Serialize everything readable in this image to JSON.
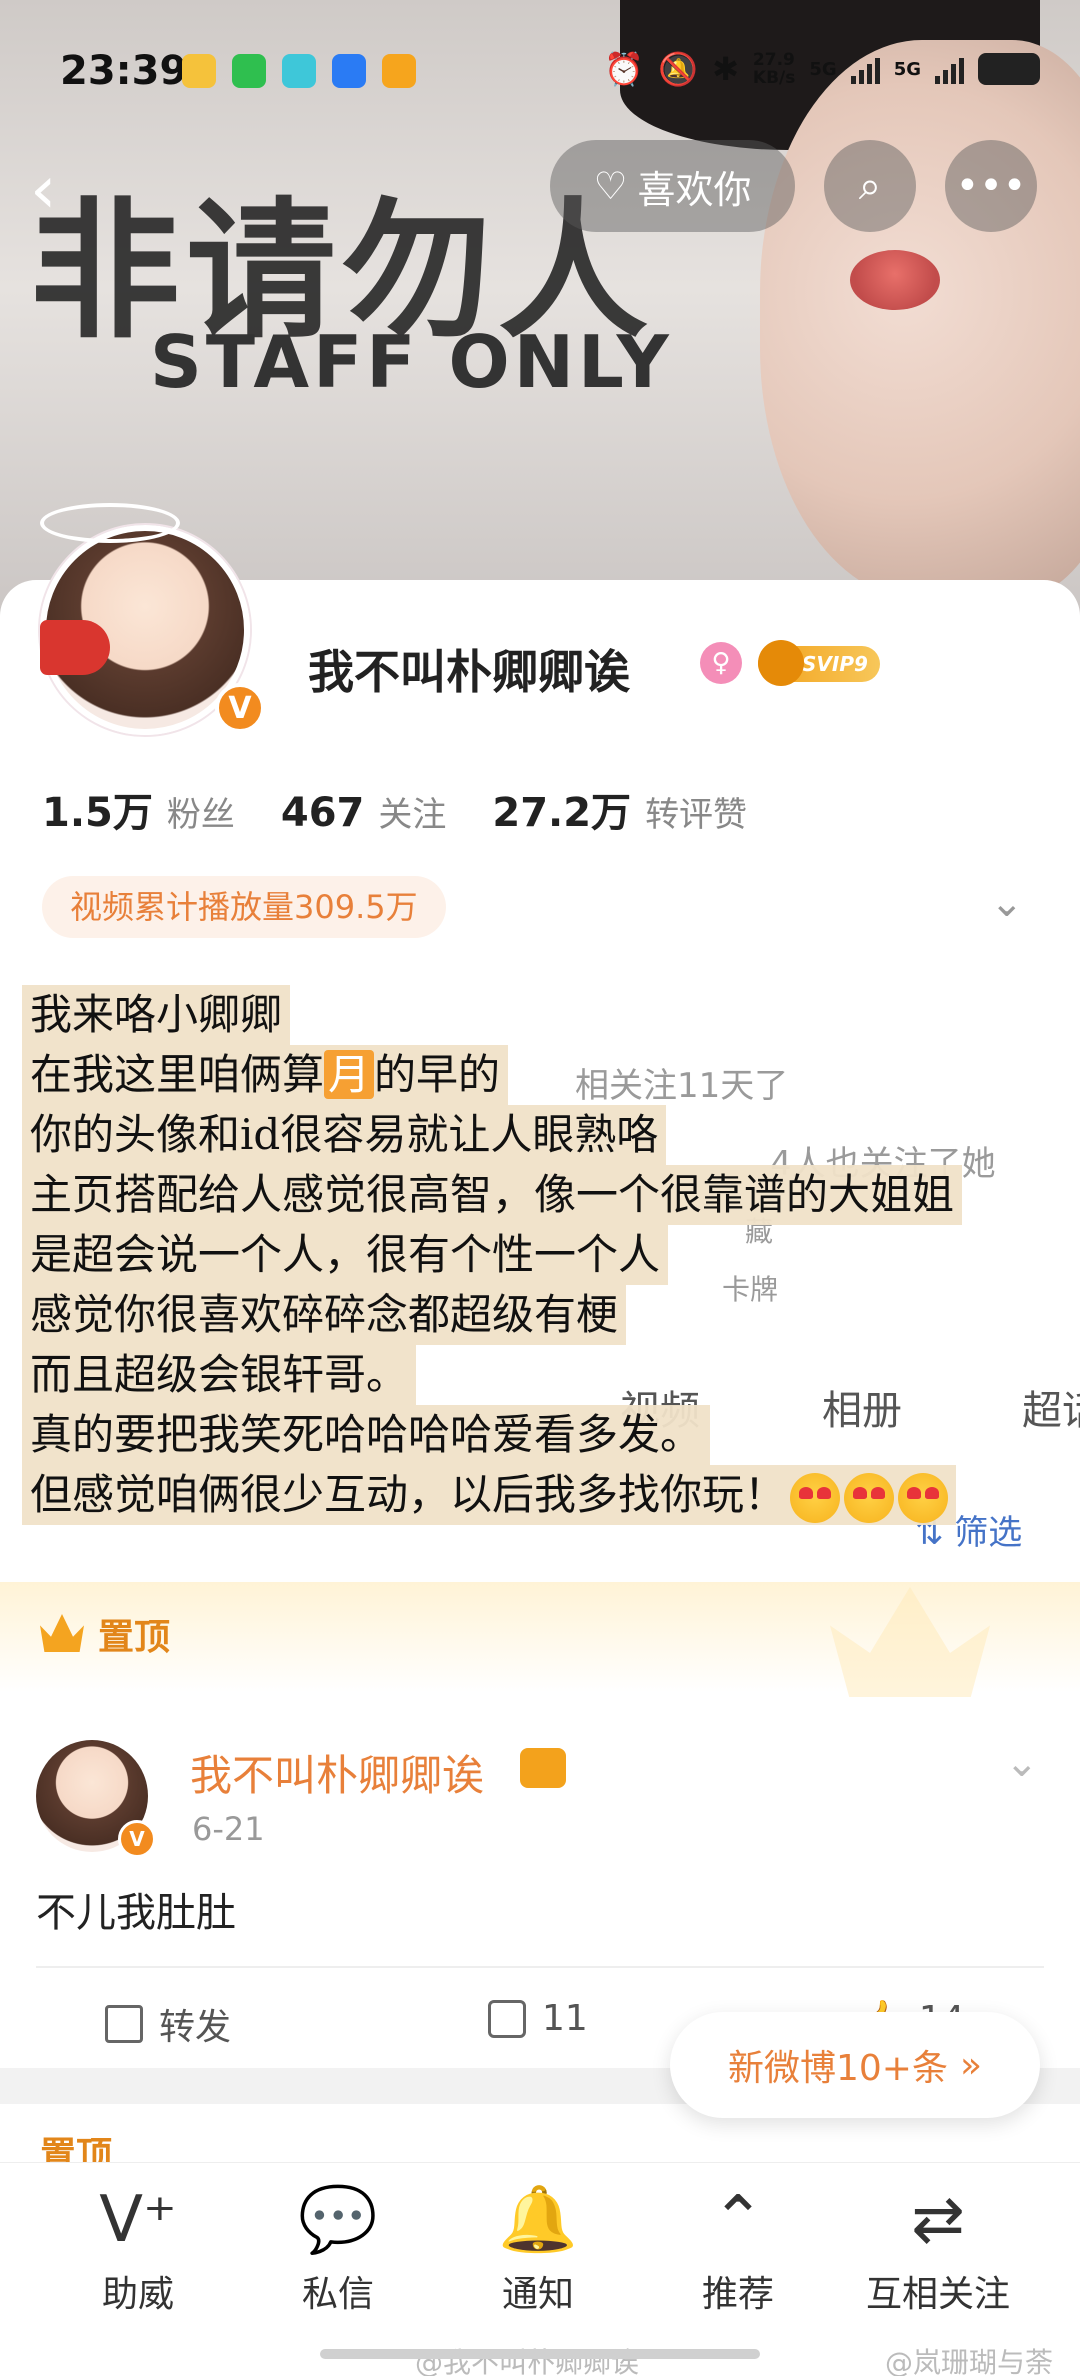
{
  "status_bar": {
    "time": "23:39",
    "network_speed": "27.9\nKB/s",
    "net_speed_top": "27.9",
    "net_speed_bottom": "KB/s",
    "signal1": "5G",
    "signal2": "5G",
    "app_icon_colors": [
      "#f5c23b",
      "#2fbf4f",
      "#3ec7d9",
      "#2a7bf4",
      "#f6a51d"
    ]
  },
  "top_nav": {
    "like_label": "喜欢你",
    "back_icon": "chevron-left-icon",
    "search_icon": "search-icon",
    "more_icon": "more-icon"
  },
  "banner": {
    "sign_text": "非请勿人",
    "sign_sub": "STAFF ONLY"
  },
  "profile": {
    "username": "我不叫朴卿卿诶",
    "svip": "SVIP9",
    "verified_mark": "V",
    "stats": [
      {
        "num": "1.5万",
        "label": "粉丝"
      },
      {
        "num": "467",
        "label": "关注"
      },
      {
        "num": "27.2万",
        "label": "转评赞"
      }
    ],
    "play_count": "视频累计播放量309.5万"
  },
  "partial_bg_text": {
    "t1": "相关注11天了",
    "t2": "4人也关注了她",
    "t3": "藏",
    "t4": "卡牌"
  },
  "note": {
    "lines": [
      "我来咯小卿卿",
      "你的头像和id很容易就让人眼熟咯",
      "主页搭配给人感觉很高智，像一个很靠谱的大姐姐",
      "是超会说一个人，很有个性一个人",
      "感觉你很喜欢碎碎念都超级有梗",
      "而且超级会银轩哥。",
      "真的要把我笑死哈哈哈哈爱看多发。",
      "但感觉咱俩很少互动，以后我多找你玩！"
    ],
    "line2_pre": "在我这里咱俩算",
    "line2_hl": "月",
    "line2_post": "的早的"
  },
  "tabs": {
    "video": "视频",
    "album": "相册",
    "super": "超话",
    "filter": "筛选"
  },
  "pinned": {
    "label": "置顶"
  },
  "post": {
    "author": "我不叫朴卿卿诶",
    "date": "6-21",
    "text": "不儿我肚肚",
    "repost": "转发",
    "comments": "11",
    "likes": "14"
  },
  "new_posts": {
    "label": "新微博10+条"
  },
  "bottom_nav": [
    {
      "label": "助威",
      "icon": "v-plus-icon"
    },
    {
      "label": "私信",
      "icon": "chat-icon"
    },
    {
      "label": "通知",
      "icon": "bell-icon"
    },
    {
      "label": "推荐",
      "icon": "chevron-up-circle-icon"
    },
    {
      "label": "互相关注",
      "icon": "mutual-follow-icon"
    }
  ],
  "watermarks": {
    "left": "@我不叫朴卿卿诶",
    "right": "@岚珊瑚与荼"
  },
  "colors": {
    "accent_orange": "#e8803a",
    "verified_orange": "#f28b1f",
    "note_bg": "#f0e2c8"
  }
}
